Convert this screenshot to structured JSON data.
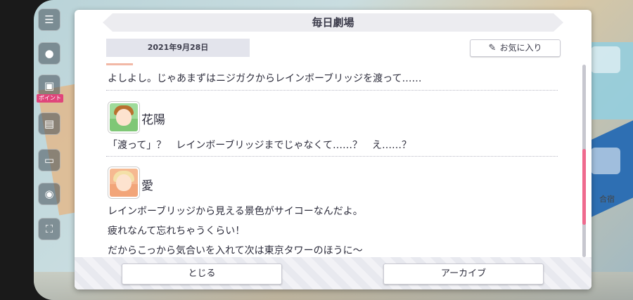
{
  "dialog": {
    "title": "毎日劇場",
    "date": "2021年9月28日",
    "favorite_label": "お気に入り",
    "close_label": "とじる",
    "archive_label": "アーカイブ"
  },
  "messages": {
    "prev_line": "よしよし。じゃあまずはニジガクからレインボーブリッジを渡って……",
    "hanayo": {
      "name": "花陽",
      "line": "「渡って」？　レインボーブリッジまでじゃなくて……？　え……？"
    },
    "ai": {
      "name": "愛",
      "line1": "レインボーブリッジから見える景色がサイコーなんだよ。",
      "line2": "疲れなんて忘れちゃうくらい！",
      "line3": "だからこっから気合いを入れて次は東京タワーのほうに～"
    }
  },
  "background": {
    "side_badge": "ポイント",
    "right_label": "合宿"
  },
  "colors": {
    "accent_pink": "#ef6a8e",
    "title_text": "#3b3b4a"
  }
}
